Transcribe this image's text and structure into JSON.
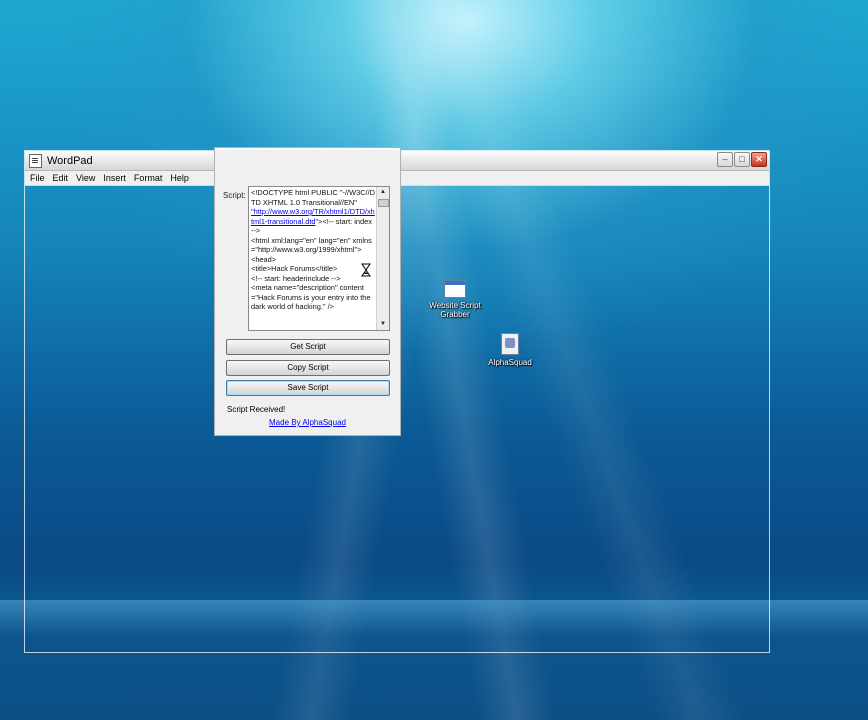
{
  "wordpad": {
    "title": "WordPad",
    "menus": [
      "File",
      "Edit",
      "View",
      "Insert",
      "Format",
      "Help"
    ],
    "controls": {
      "minimize": "–",
      "maximize": "□",
      "close": "✕"
    }
  },
  "grabber": {
    "script_label": "Script:",
    "script_lines": [
      {
        "text": "<!DOCTYPE html PUBLIC \"-//W3C//DTD XHTML 1.0 Transitional//EN\"",
        "link": false
      },
      {
        "text": "\"http://www.w3.org/TR/xhtml1/DTD/xhtml1-transitional.dtd",
        "link": true
      },
      {
        "text": "\"><!-- start: index -->",
        "link": false
      },
      {
        "text": "<html xml:lang=\"en\" lang=\"en\" xmlns=\"http://www.w3.org/1999/xhtml\">",
        "link": false
      },
      {
        "text": "<head>",
        "link": false
      },
      {
        "text": "<title>Hack Forums</title>",
        "link": false
      },
      {
        "text": "<!-- start: headerinclude -->",
        "link": false
      },
      {
        "text": "<meta name=\"description\" content=\"Hack Forums is your entry into the dark world of hacking.\" />",
        "link": false
      }
    ],
    "buttons": {
      "get": "Get Script",
      "copy": "Copy Script",
      "save": "Save Script"
    },
    "status": "Script Received!",
    "credit": "Made By AlphaSquad"
  },
  "desktop": {
    "icons": [
      {
        "label_1": "Website Script",
        "label_2": "Grabber",
        "icon": "window-app-icon"
      },
      {
        "label_1": "AlphaSquad",
        "icon": "document-icon"
      }
    ]
  }
}
